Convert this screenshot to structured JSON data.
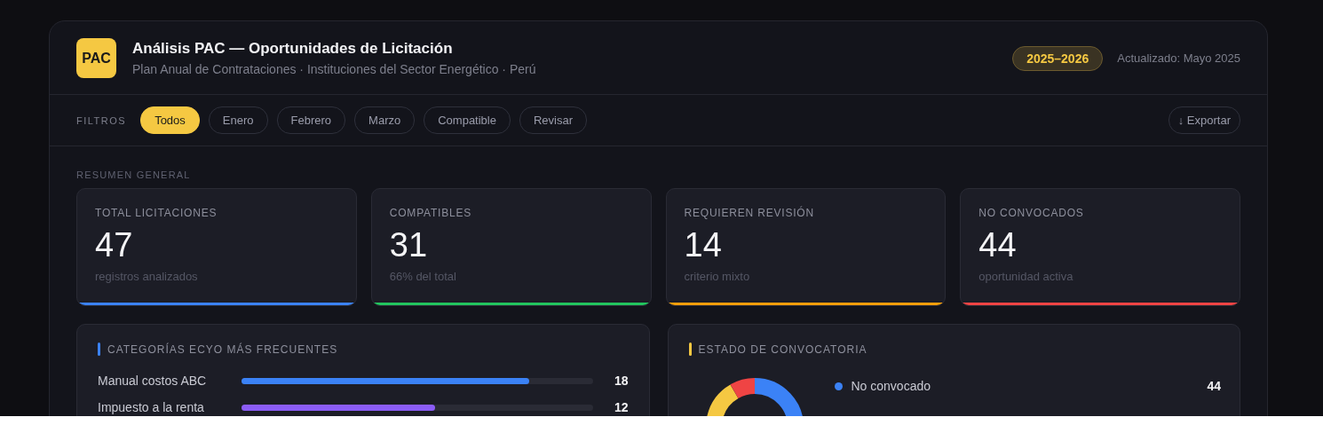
{
  "header": {
    "logo": "PAC",
    "title": "Análisis PAC — Oportunidades de Licitación",
    "subtitle": "Plan Anual de Contrataciones · Instituciones del Sector Energético · Perú",
    "period": "2025–2026",
    "updated": "Actualizado: Mayo 2025"
  },
  "filters": {
    "label": "FILTROS",
    "chips": [
      {
        "label": "Todos",
        "selected": true
      },
      {
        "label": "Enero",
        "selected": false
      },
      {
        "label": "Febrero",
        "selected": false
      },
      {
        "label": "Marzo",
        "selected": false
      },
      {
        "label": "Compatible",
        "selected": false
      },
      {
        "label": "Revisar",
        "selected": false
      }
    ],
    "export": "↓ Exportar"
  },
  "summary": {
    "title": "RESUMEN GENERAL",
    "cards": [
      {
        "label": "TOTAL LICITACIONES",
        "value": "47",
        "note": "registros analizados",
        "color": "#3b82f6"
      },
      {
        "label": "COMPATIBLES",
        "value": "31",
        "note": "66% del total",
        "color": "#22c55e"
      },
      {
        "label": "REQUIEREN REVISIÓN",
        "value": "14",
        "note": "criterio mixto",
        "color": "#f59e0b"
      },
      {
        "label": "NO CONVOCADOS",
        "value": "44",
        "note": "oportunidad activa",
        "color": "#ef4444"
      }
    ]
  },
  "panels": [
    {
      "kind": "bars",
      "title": "CATEGORÍAS ECYO MÁS FRECUENTES",
      "color": "#3b82f6",
      "items": [
        {
          "name": "Manual costos ABC",
          "level": 0.82,
          "count": "18",
          "color": "#3b82f6"
        },
        {
          "name": "Impuesto a la renta",
          "level": 0.55,
          "count": "12",
          "color": "#8b5cf6"
        }
      ]
    },
    {
      "kind": "donut",
      "title": "ESTADO DE CONVOCATORIA",
      "color": "#f5c842",
      "legend": [
        {
          "name": "No convocado",
          "count": "44",
          "color": "#3b82f6"
        }
      ]
    }
  ]
}
